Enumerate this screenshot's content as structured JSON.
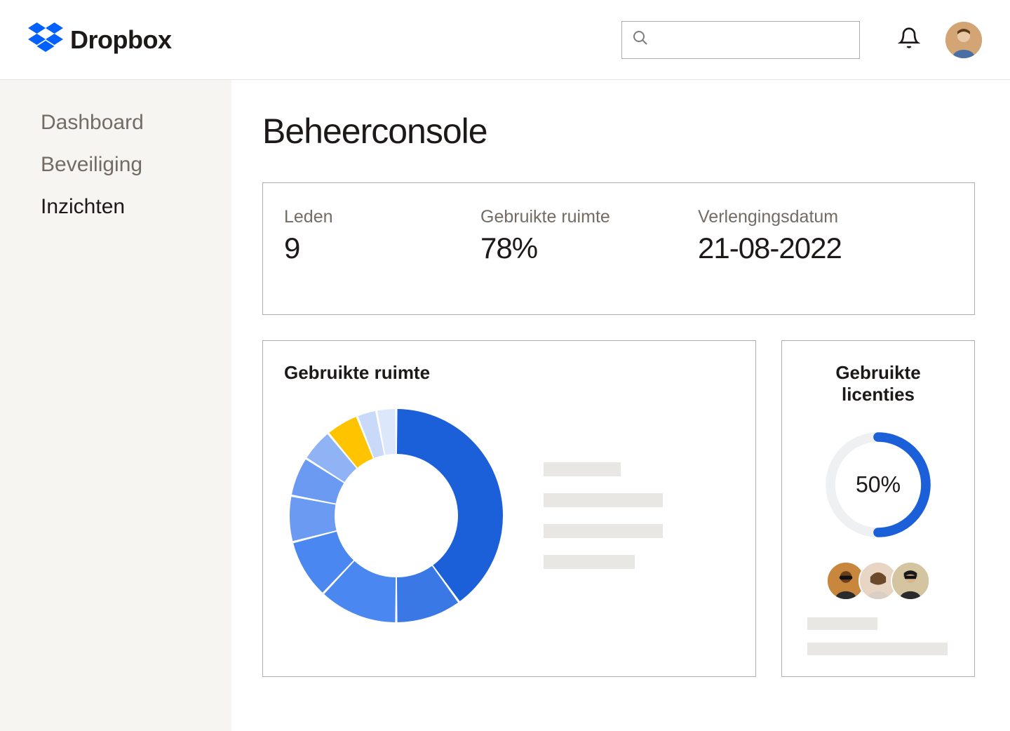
{
  "header": {
    "brand": "Dropbox",
    "search_placeholder": ""
  },
  "sidebar": {
    "items": [
      {
        "label": "Dashboard",
        "active": false
      },
      {
        "label": "Beveiliging",
        "active": false
      },
      {
        "label": "Inzichten",
        "active": true
      }
    ]
  },
  "page": {
    "title": "Beheerconsole"
  },
  "stats": [
    {
      "label": "Leden",
      "value": "9"
    },
    {
      "label": "Gebruikte ruimte",
      "value": "78%"
    },
    {
      "label": "Verlengingsdatum",
      "value": "21-08-2022"
    }
  ],
  "panels": {
    "space": {
      "title": "Gebruikte ruimte"
    },
    "licenses": {
      "title": "Gebruikte licenties",
      "percent_label": "50%",
      "percent": 50
    }
  },
  "chart_data": [
    {
      "type": "pie",
      "title": "Gebruikte ruimte",
      "series": [
        {
          "name": "segment-1",
          "value": 40,
          "color": "#1b5fd9"
        },
        {
          "name": "segment-2",
          "value": 10,
          "color": "#3a78e6"
        },
        {
          "name": "segment-3",
          "value": 12,
          "color": "#4b87f0"
        },
        {
          "name": "segment-4",
          "value": 9,
          "color": "#4b87f0"
        },
        {
          "name": "segment-5",
          "value": 7,
          "color": "#6a9af2"
        },
        {
          "name": "segment-6",
          "value": 6,
          "color": "#6a9af2"
        },
        {
          "name": "segment-7",
          "value": 5,
          "color": "#8fb3f5"
        },
        {
          "name": "segment-8",
          "value": 5,
          "color": "#ffc300"
        },
        {
          "name": "segment-9",
          "value": 3,
          "color": "#c9d9f9"
        },
        {
          "name": "segment-10",
          "value": 3,
          "color": "#dde7fb"
        }
      ]
    },
    {
      "type": "pie",
      "title": "Gebruikte licenties",
      "series": [
        {
          "name": "used",
          "value": 50,
          "color": "#1b5fd9"
        },
        {
          "name": "remaining",
          "value": 50,
          "color": "#eef0f2"
        }
      ]
    }
  ]
}
